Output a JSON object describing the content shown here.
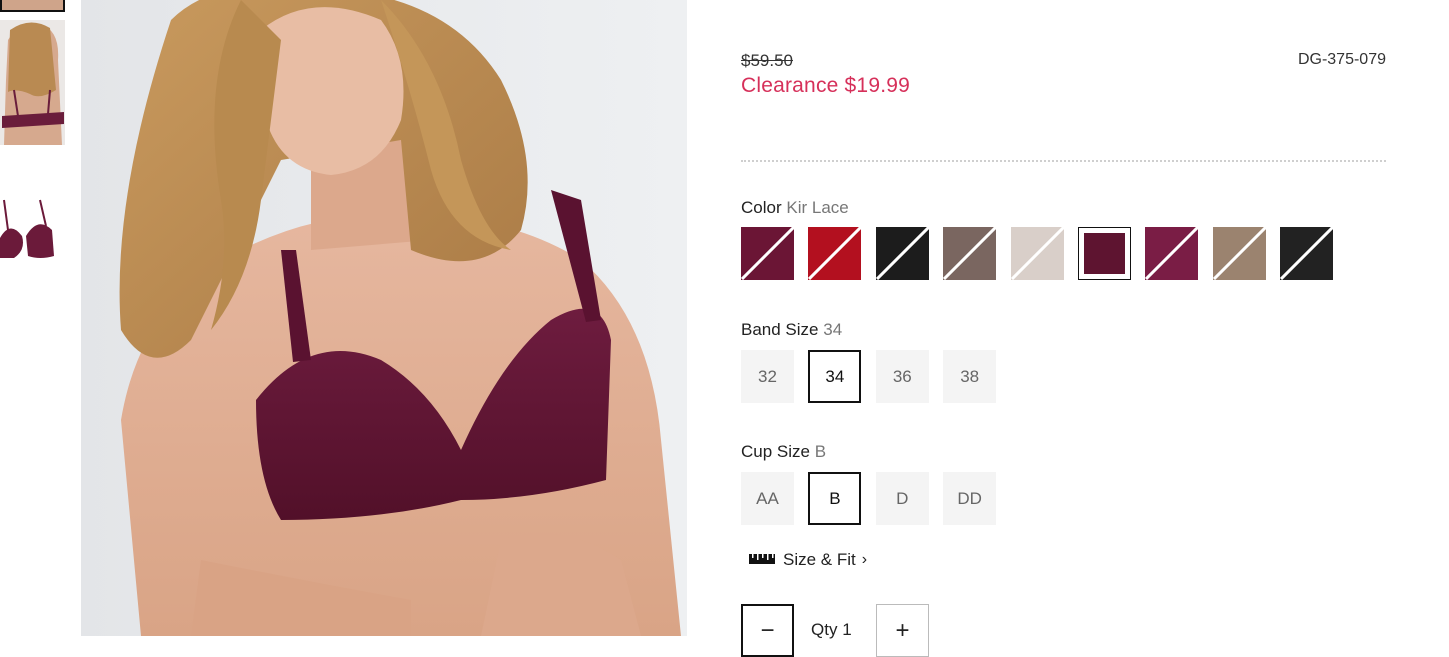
{
  "price": {
    "original": "$59.50",
    "sale": "Clearance $19.99",
    "sku": "DG-375-079"
  },
  "color": {
    "label": "Color",
    "selected": "Kir Lace",
    "swatches": [
      {
        "color": "#6b1535",
        "selected": false
      },
      {
        "color": "#b3101f",
        "selected": false
      },
      {
        "color": "#1c1c1c",
        "selected": false
      },
      {
        "color": "#7a6660",
        "selected": false
      },
      {
        "color": "#d9cfc9",
        "selected": false
      },
      {
        "color": "#5e1430",
        "selected": true
      },
      {
        "color": "#7a1d45",
        "selected": false
      },
      {
        "color": "#9b836f",
        "selected": false
      },
      {
        "color": "#222222",
        "selected": false
      }
    ]
  },
  "band": {
    "label": "Band Size",
    "selected": "34",
    "options": [
      "32",
      "34",
      "36",
      "38"
    ]
  },
  "cup": {
    "label": "Cup Size",
    "selected": "B",
    "options": [
      "AA",
      "B",
      "D",
      "DD"
    ]
  },
  "size_fit": {
    "label": "Size & Fit",
    "icon": "ruler-icon"
  },
  "quantity": {
    "label": "Qty",
    "value": "1",
    "minus": "−",
    "plus": "+"
  }
}
